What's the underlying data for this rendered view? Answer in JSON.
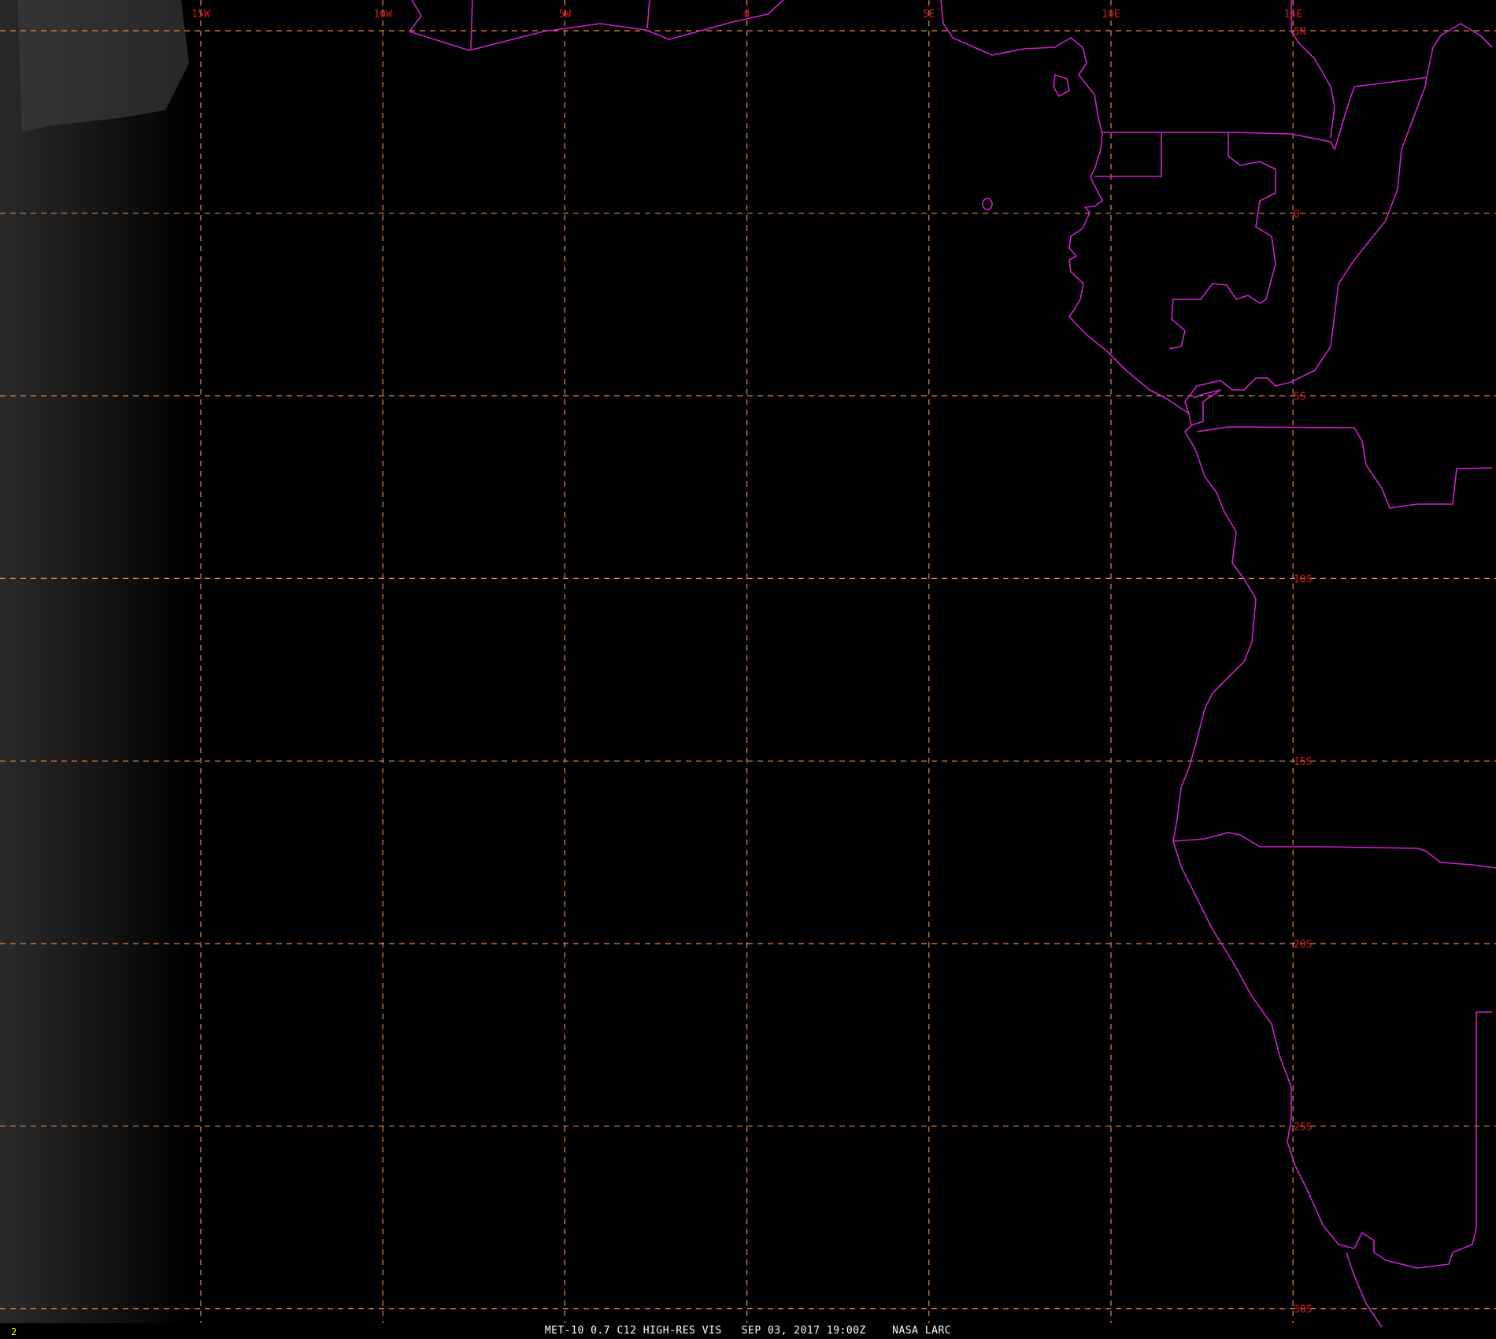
{
  "colors": {
    "background": "#000000",
    "gridline": "#e8894a",
    "grid_label": "#d11a1a",
    "coastline": "#cc22cc",
    "footer_text": "#ffffff",
    "frame_number": "#ffff00"
  },
  "grid": {
    "longitude_labels": [
      "15W",
      "10W",
      "5W",
      "0",
      "5E",
      "10E",
      "15E"
    ],
    "latitude_labels": [
      "5N",
      "0",
      "5S",
      "10S",
      "15S",
      "20S",
      "25S",
      "30S"
    ]
  },
  "footer": {
    "frame_number": "2",
    "caption": "MET-10 0.7 C12 HIGH-RES VIS   SEP 03, 2017 19:00Z    NASA LARC"
  }
}
